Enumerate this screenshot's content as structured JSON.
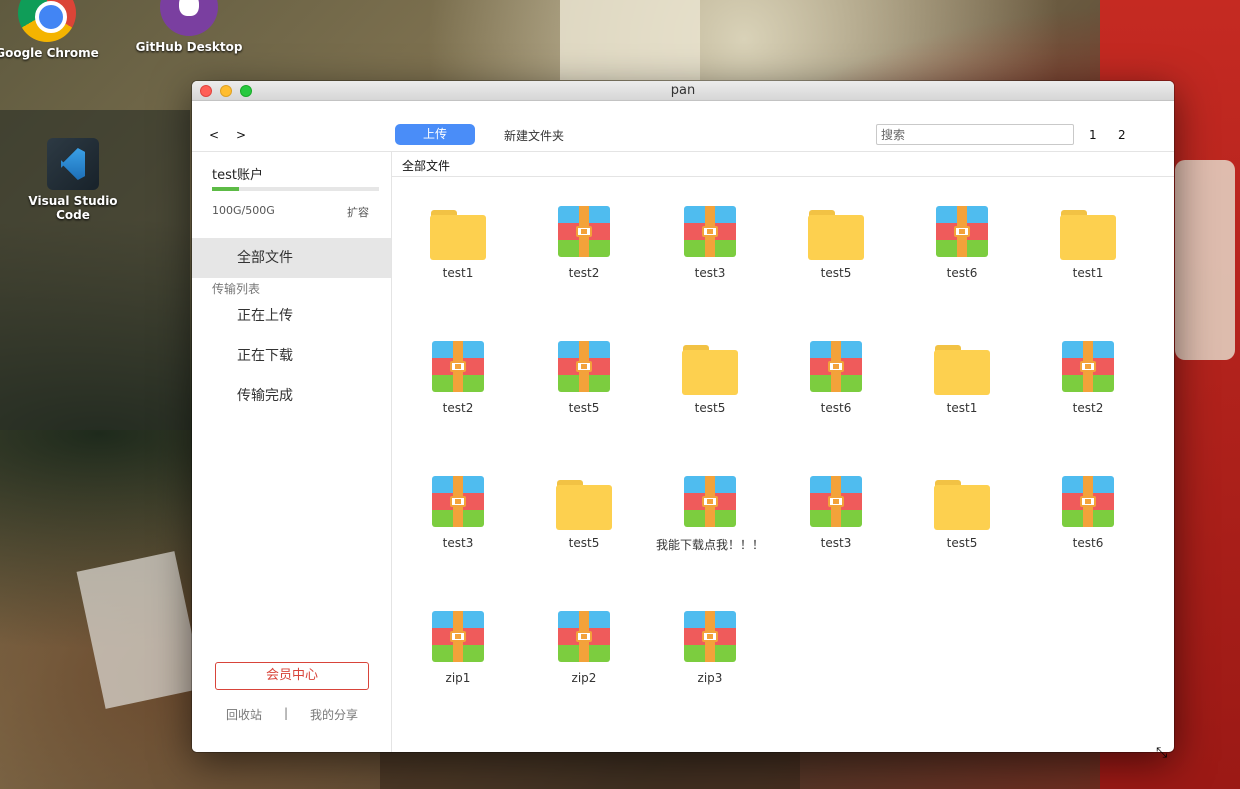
{
  "desktop": {
    "icons": [
      {
        "label": "Google Chrome"
      },
      {
        "label": "GitHub Desktop"
      },
      {
        "label": "Visual Studio Code"
      }
    ]
  },
  "window": {
    "title": "pan"
  },
  "toolbar": {
    "back_label": "<",
    "forward_label": ">",
    "upload_label": "上传",
    "new_folder_label": "新建文件夹",
    "search_placeholder": "搜索",
    "pages": [
      "1",
      "2"
    ]
  },
  "sidebar": {
    "account_name": "test账户",
    "quota_text": "100G/500G",
    "quota_used_fraction": 0.16,
    "expand_label": "扩容",
    "all_files_label": "全部文件",
    "transfer_section_label": "传输列表",
    "uploading_label": "正在上传",
    "downloading_label": "正在下载",
    "completed_label": "传输完成",
    "vip_label": "会员中心",
    "recycle_label": "回收站",
    "separator": "|",
    "share_label": "我的分享"
  },
  "main": {
    "breadcrumb": "全部文件",
    "files": [
      {
        "name": "test1",
        "type": "folder"
      },
      {
        "name": "test2",
        "type": "archive"
      },
      {
        "name": "test3",
        "type": "archive"
      },
      {
        "name": "test5",
        "type": "folder"
      },
      {
        "name": "test6",
        "type": "archive"
      },
      {
        "name": "test1",
        "type": "folder"
      },
      {
        "name": "test2",
        "type": "archive"
      },
      {
        "name": "test5",
        "type": "archive"
      },
      {
        "name": "test5",
        "type": "folder"
      },
      {
        "name": "test6",
        "type": "archive"
      },
      {
        "name": "test1",
        "type": "folder"
      },
      {
        "name": "test2",
        "type": "archive"
      },
      {
        "name": "test3",
        "type": "archive"
      },
      {
        "name": "test5",
        "type": "folder"
      },
      {
        "name": "我能下载点我！！！",
        "type": "archive"
      },
      {
        "name": "test3",
        "type": "archive"
      },
      {
        "name": "test5",
        "type": "folder"
      },
      {
        "name": "test6",
        "type": "archive"
      },
      {
        "name": "zip1",
        "type": "archive"
      },
      {
        "name": "zip2",
        "type": "archive"
      },
      {
        "name": "zip3",
        "type": "archive"
      }
    ]
  },
  "colors": {
    "accent": "#4a8df8",
    "vip": "#d8443a",
    "quota": "#5dbb46"
  }
}
